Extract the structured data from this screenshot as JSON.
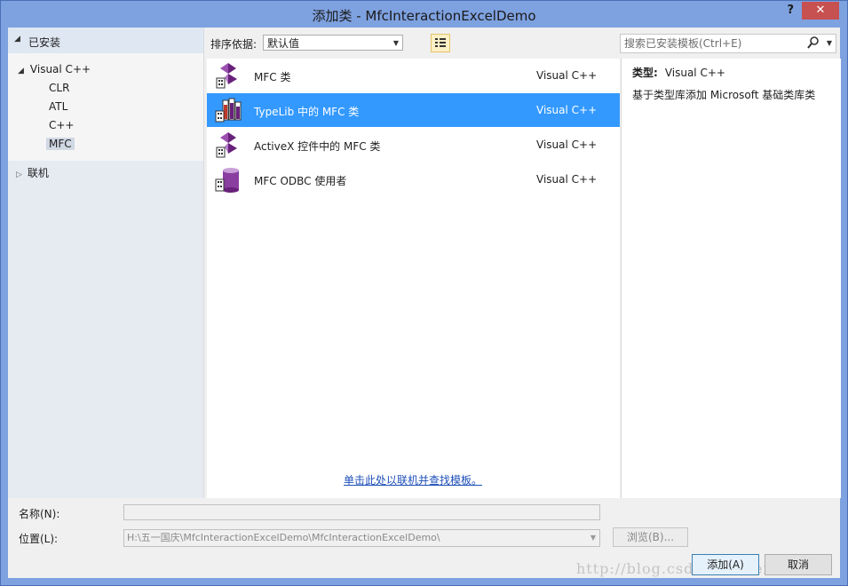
{
  "window": {
    "title": "添加类 - MfcInteractionExcelDemo",
    "help": "?",
    "close": "✕"
  },
  "left": {
    "installed": "已安装",
    "tree": {
      "visual_cpp": "Visual C++",
      "children": [
        "CLR",
        "ATL",
        "C++",
        "MFC"
      ],
      "selected": "MFC",
      "online": "联机"
    }
  },
  "toolbar": {
    "sort_label": "排序依据:",
    "sort_value": "默认值",
    "search_placeholder": "搜索已安装模板(Ctrl+E)"
  },
  "templates": [
    {
      "name": "MFC 类",
      "lang": "Visual C++",
      "icon": "mfc-class-icon",
      "selected": false
    },
    {
      "name": "TypeLib 中的 MFC 类",
      "lang": "Visual C++",
      "icon": "typelib-icon",
      "selected": true
    },
    {
      "name": "ActiveX 控件中的 MFC 类",
      "lang": "Visual C++",
      "icon": "activex-icon",
      "selected": false
    },
    {
      "name": "MFC ODBC 使用者",
      "lang": "Visual C++",
      "icon": "database-icon",
      "selected": false
    }
  ],
  "online_link": "单击此处以联机并查找模板。",
  "description": {
    "type_label": "类型:",
    "type_value": "Visual C++",
    "text": "基于类型库添加 Microsoft 基础类库类"
  },
  "form": {
    "name_label": "名称(N):",
    "name_value": "",
    "location_label": "位置(L):",
    "location_value": "H:\\五一国庆\\MfcInteractionExcelDemo\\MfcInteractionExcelDemo\\",
    "browse": "浏览(B)...",
    "add": "添加(A)",
    "cancel": "取消"
  },
  "watermark": "http://blog.csdn.net/weixinbhm",
  "colors": {
    "selection": "#3399ff",
    "title_bar": "#7ea1e0",
    "link": "#1e4fb8",
    "close": "#c75050"
  }
}
